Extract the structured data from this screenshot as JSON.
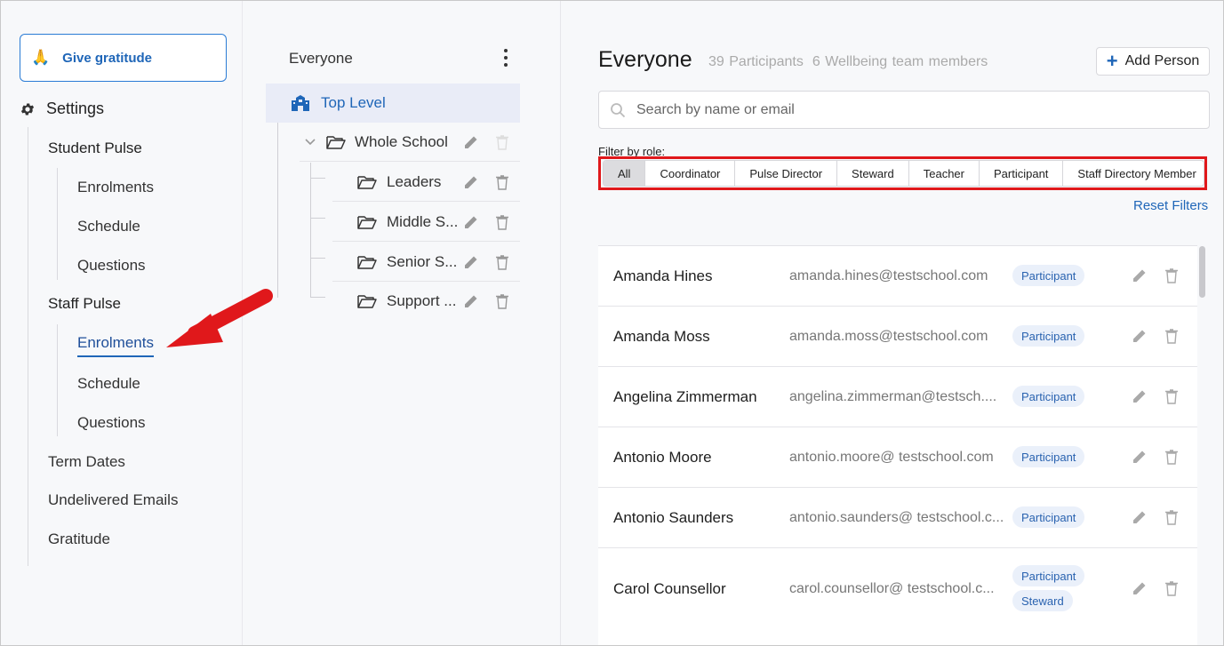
{
  "sidebar": {
    "gratitude_label": "Give gratitude",
    "settings_label": "Settings",
    "student_pulse": {
      "label": "Student Pulse",
      "items": [
        "Enrolments",
        "Schedule",
        "Questions"
      ]
    },
    "staff_pulse": {
      "label": "Staff Pulse",
      "items": [
        "Enrolments",
        "Schedule",
        "Questions"
      ],
      "active_item": "Enrolments"
    },
    "other": [
      "Term Dates",
      "Undelivered Emails",
      "Gratitude"
    ]
  },
  "tree": {
    "title": "Everyone",
    "top_level": "Top Level",
    "nodes": [
      {
        "label": "Whole School",
        "level": 1
      },
      {
        "label": "Leaders",
        "level": 2
      },
      {
        "label": "Middle S...",
        "level": 2
      },
      {
        "label": "Senior S...",
        "level": 2
      },
      {
        "label": "Support ...",
        "level": 2
      }
    ]
  },
  "main": {
    "title": "Everyone",
    "participants": "39 Participants",
    "wellbeing": "6 Wellbeing team members",
    "add_person": "Add Person",
    "search_placeholder": "Search by name or email",
    "filter_label": "Filter by role:",
    "filters": [
      "All",
      "Coordinator",
      "Pulse Director",
      "Steward",
      "Teacher",
      "Participant",
      "Staff Directory Member"
    ],
    "active_filter": "All",
    "reset_filters": "Reset Filters",
    "people": [
      {
        "name": "Amanda Hines",
        "email": "amanda.hines@testschool.com",
        "roles": [
          "Participant"
        ]
      },
      {
        "name": "Amanda Moss",
        "email": "amanda.moss@testschool.com",
        "roles": [
          "Participant"
        ]
      },
      {
        "name": "Angelina Zimmerman",
        "email": "angelina.zimmerman@testsch....",
        "roles": [
          "Participant"
        ]
      },
      {
        "name": "Antonio Moore",
        "email": "antonio.moore@ testschool.com",
        "roles": [
          "Participant"
        ]
      },
      {
        "name": "Antonio Saunders",
        "email": "antonio.saunders@ testschool.c...",
        "roles": [
          "Participant"
        ]
      },
      {
        "name": "Carol Counsellor",
        "email": "carol.counsellor@ testschool.c...",
        "roles": [
          "Participant",
          "Steward"
        ]
      }
    ]
  },
  "colors": {
    "accent": "#1f66b8",
    "highlight_red": "#e0181b",
    "badge_bg": "#eaf0fa",
    "selected_bg": "#e9ecf7"
  }
}
